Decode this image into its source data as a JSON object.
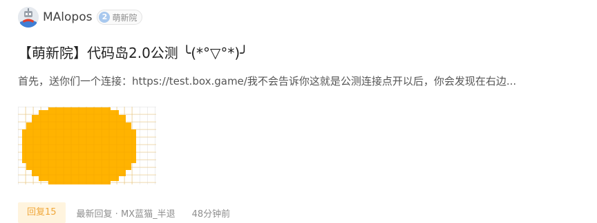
{
  "author": {
    "avatar_icon": "robot-avatar-icon",
    "name": "MAlopos",
    "badge_level": "2",
    "badge_label": "萌新院"
  },
  "post": {
    "title": "【萌新院】代码岛2.0公测 ╰(*°▽°*)╯",
    "excerpt": "首先，送你们一个连接：https://test.box.game/我不会告诉你这就是公测连接点开以后，你会发现在右边...",
    "thumbnail_icon": "yellow-ellipse-pixel-thumbnail",
    "thumbnail_color": "#ffb300"
  },
  "footer": {
    "reply_label": "回复15",
    "latest_reply": "最新回复 · MX蓝猫_半退",
    "time": "48分钟前"
  },
  "colors": {
    "reply_pill_bg": "#fff4de",
    "reply_pill_text": "#f0a73a",
    "badge_circle": "#a8c8ee"
  }
}
